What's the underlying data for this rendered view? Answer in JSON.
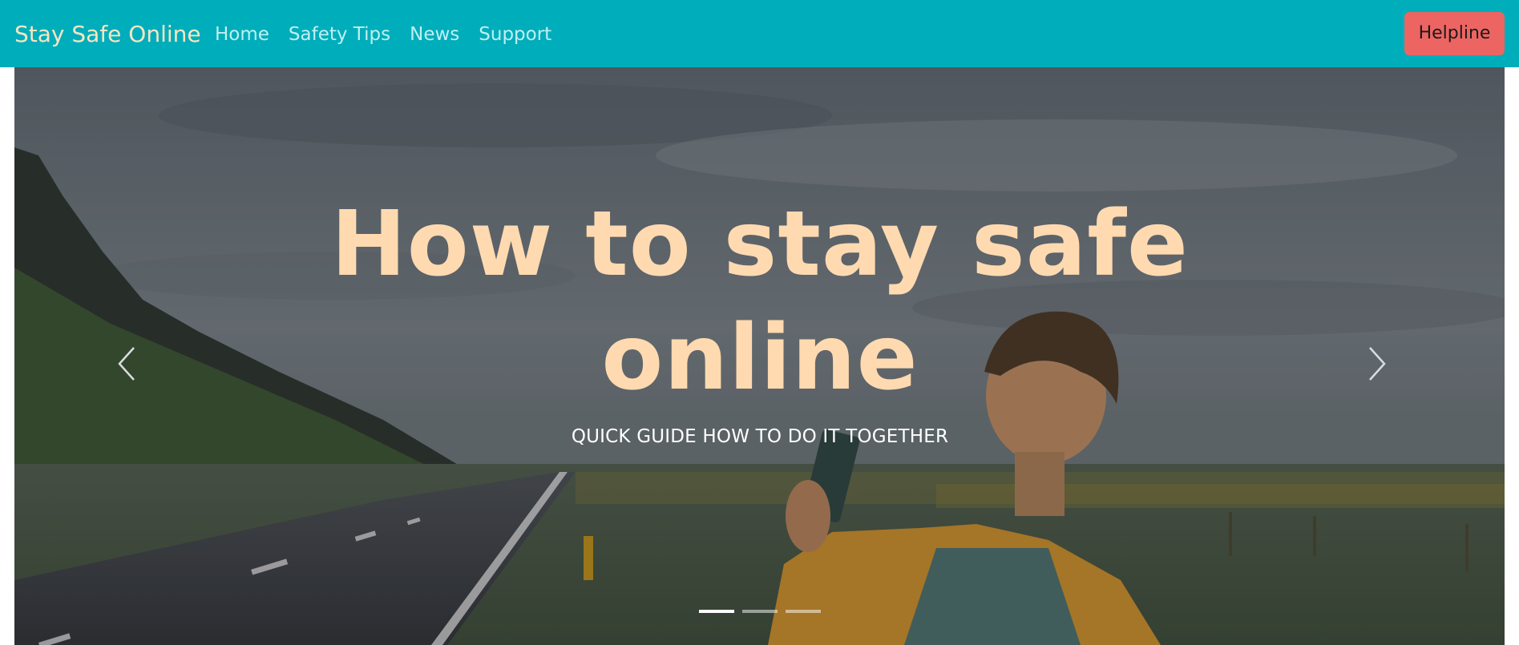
{
  "navbar": {
    "brand": "Stay Safe Online",
    "links": [
      {
        "label": "Home"
      },
      {
        "label": "Safety Tips"
      },
      {
        "label": "News"
      },
      {
        "label": "Support"
      }
    ],
    "helpline_label": "Helpline",
    "background": "#00adbb",
    "helpline_color": "#ec6562"
  },
  "hero": {
    "title": "How to stay safe online",
    "subtitle": "QUICK GUIDE HOW TO DO IT TOGETHER",
    "title_color": "#ffdab0",
    "prev_icon": "chevron-left-icon",
    "next_icon": "chevron-right-icon",
    "slides_count": 3,
    "active_slide": 1
  }
}
